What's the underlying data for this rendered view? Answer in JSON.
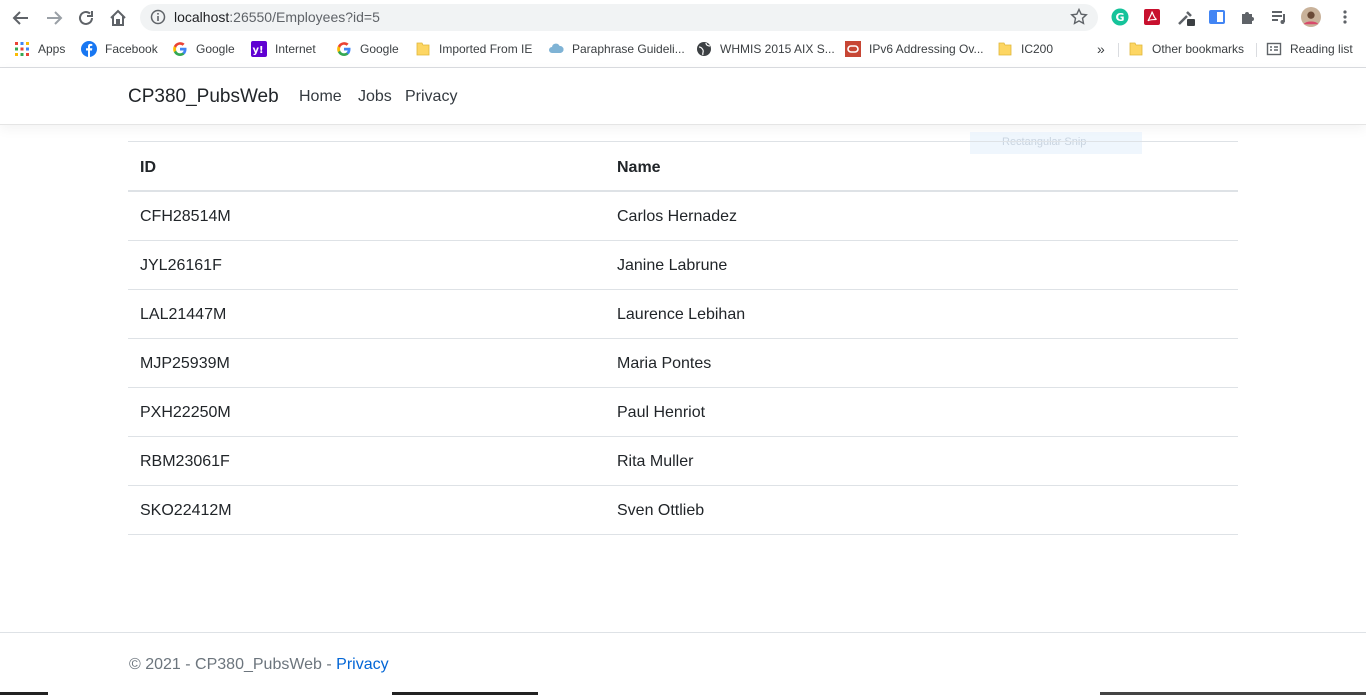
{
  "browser": {
    "url_host": "localhost",
    "url_path": ":26550/Employees?id=5",
    "bookmarks": [
      {
        "label": "Apps",
        "icon": "apps-grid-icon"
      },
      {
        "label": "Facebook",
        "icon": "facebook-icon"
      },
      {
        "label": "Google",
        "icon": "google-icon"
      },
      {
        "label": "Internet",
        "icon": "yahoo-icon"
      },
      {
        "label": "Google",
        "icon": "google-icon"
      },
      {
        "label": "Imported From IE",
        "icon": "folder-icon"
      },
      {
        "label": "Paraphrase Guideli...",
        "icon": "cloud-icon"
      },
      {
        "label": "WHMIS 2015 AIX S...",
        "icon": "globe-icon"
      },
      {
        "label": "IPv6 Addressing Ov...",
        "icon": "oracle-icon"
      },
      {
        "label": "IC200",
        "icon": "folder-icon"
      }
    ],
    "more_bookmarks": "»",
    "other_bookmarks": "Other bookmarks",
    "reading_list": "Reading list"
  },
  "site": {
    "brand": "CP380_PubsWeb",
    "nav": [
      "Home",
      "Jobs",
      "Privacy"
    ]
  },
  "overlay": {
    "snip_label": "Rectangular Snip"
  },
  "table": {
    "headers": [
      "ID",
      "Name"
    ],
    "rows": [
      {
        "id": "CFH28514M",
        "name": "Carlos Hernadez"
      },
      {
        "id": "JYL26161F",
        "name": "Janine Labrune"
      },
      {
        "id": "LAL21447M",
        "name": "Laurence Lebihan"
      },
      {
        "id": "MJP25939M",
        "name": "Maria Pontes"
      },
      {
        "id": "PXH22250M",
        "name": "Paul Henriot"
      },
      {
        "id": "RBM23061F",
        "name": "Rita Muller"
      },
      {
        "id": "SKO22412M",
        "name": "Sven Ottlieb"
      }
    ]
  },
  "footer": {
    "text": "© 2021 - CP380_PubsWeb - ",
    "link": "Privacy"
  },
  "colors": {
    "link": "#0366d6",
    "footer_text": "#6c757d",
    "border": "#dee2e6"
  }
}
